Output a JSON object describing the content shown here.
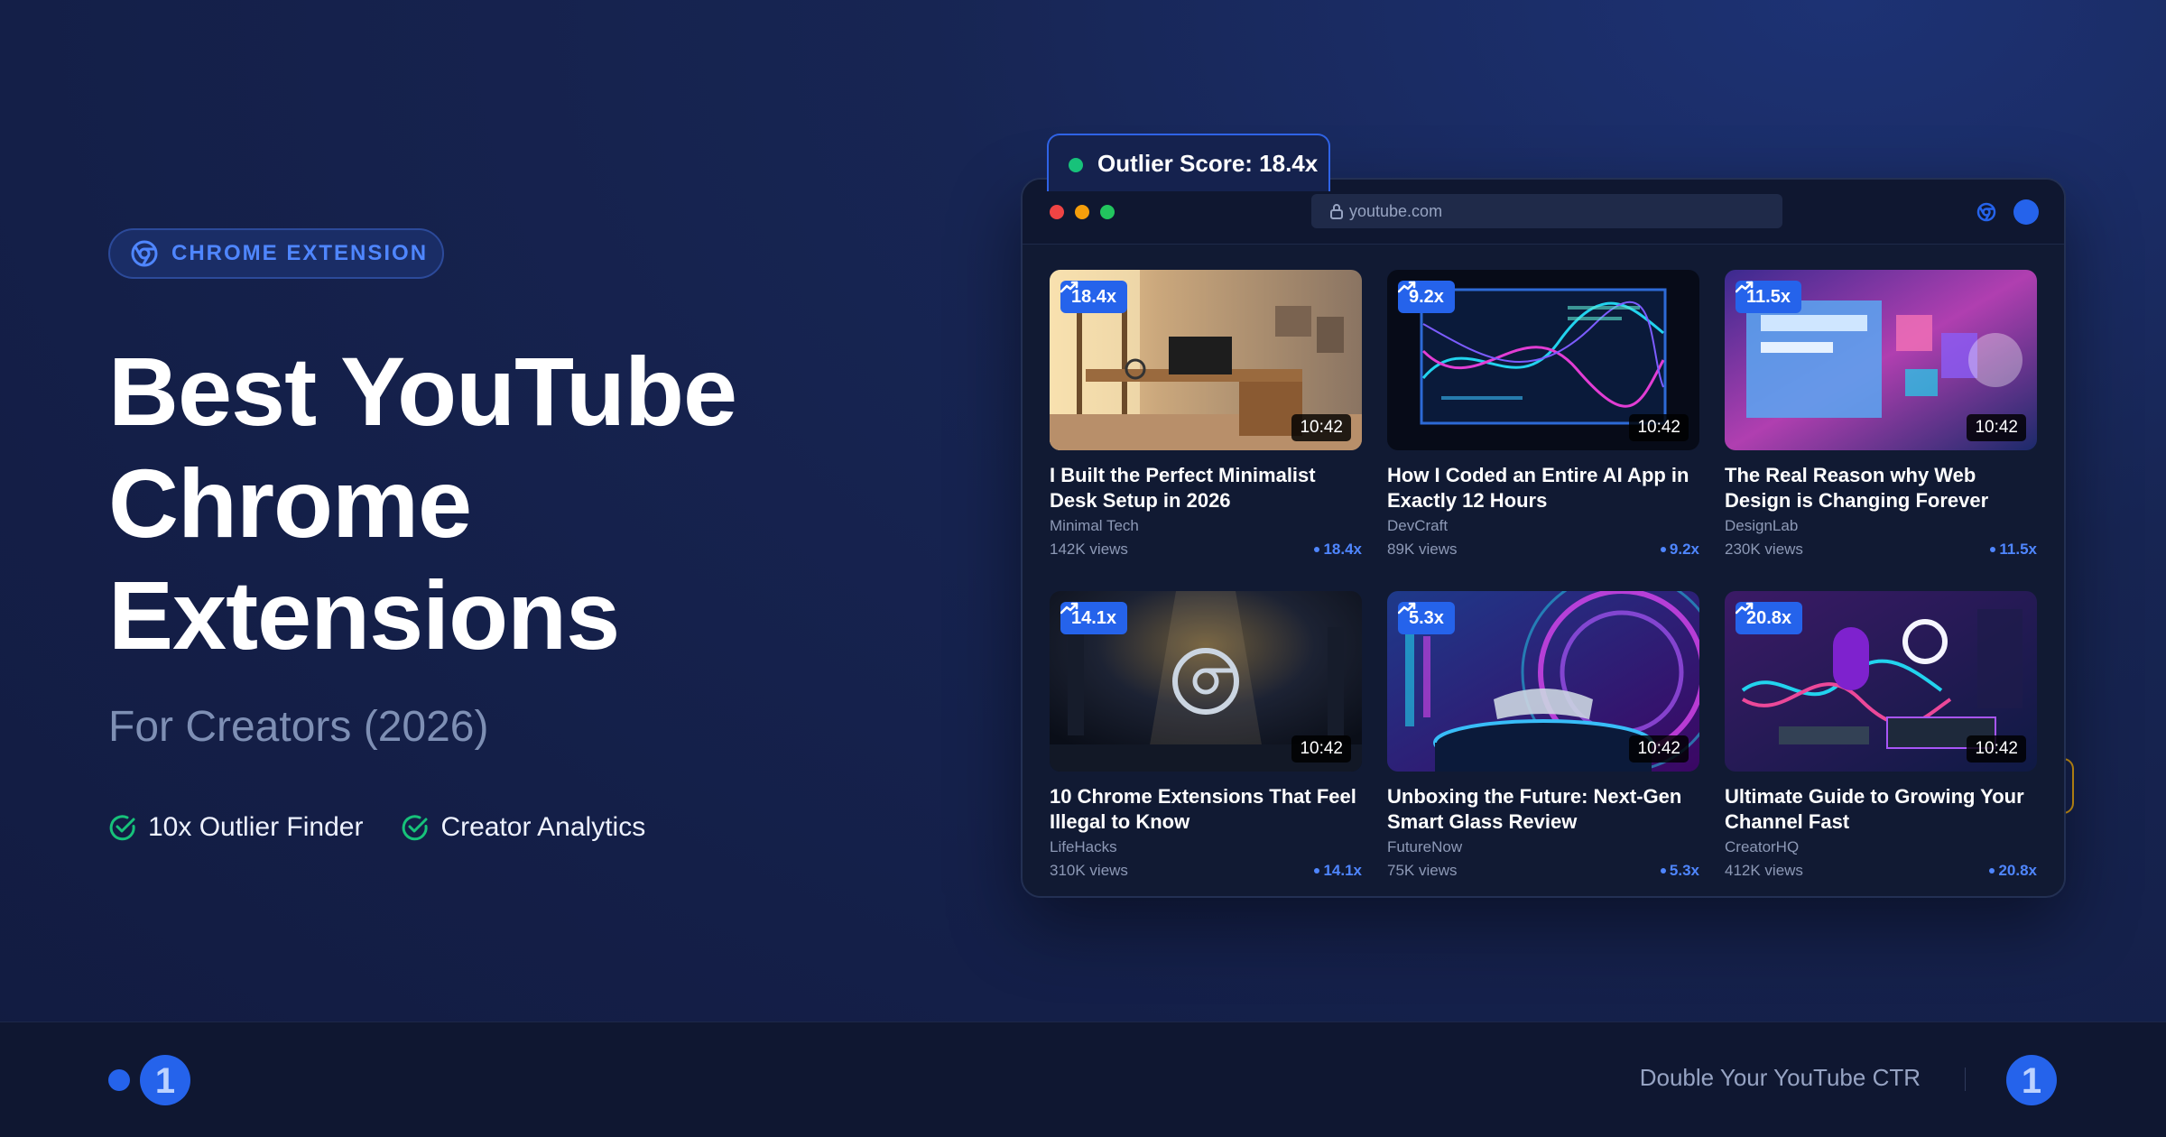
{
  "hero": {
    "badge": "CHROME EXTENSION",
    "title_lines": [
      "Best YouTube",
      "Chrome",
      "Extensions"
    ],
    "subtitle": "For Creators (2026)",
    "features": [
      "10x Outlier Finder",
      "Creator Analytics"
    ]
  },
  "score_tag": "Outlier Score: 18.4x",
  "browser": {
    "url": "youtube.com"
  },
  "videos": [
    {
      "title": "I Built the Perfect Minimalist Desk Setup in 2026",
      "channel": "Minimal Tech",
      "views": "142K views",
      "score": "18.4x",
      "duration": "10:42"
    },
    {
      "title": "How I Coded an Entire AI App in Exactly 12 Hours",
      "channel": "DevCraft",
      "views": "89K views",
      "score": "9.2x",
      "duration": "10:42"
    },
    {
      "title": "The Real Reason why Web Design is Changing Forever",
      "channel": "DesignLab",
      "views": "230K views",
      "score": "11.5x",
      "duration": "10:42"
    },
    {
      "title": "10 Chrome Extensions That Feel Illegal to Know",
      "channel": "LifeHacks",
      "views": "310K views",
      "score": "14.1x",
      "duration": "10:42"
    },
    {
      "title": "Unboxing the Future: Next-Gen Smart Glass Review",
      "channel": "FutureNow",
      "views": "75K views",
      "score": "5.3x",
      "duration": "10:42"
    },
    {
      "title": "Ultimate Guide to Growing Your Channel Fast",
      "channel": "CreatorHQ",
      "views": "412K views",
      "score": "20.8x",
      "duration": "10:42"
    }
  ],
  "footer": {
    "cta": "Double Your YouTube CTR",
    "logo_glyph": "1"
  },
  "colors": {
    "accent": "#2563eb",
    "success": "#17c27a",
    "highlight": "#d49a16"
  }
}
